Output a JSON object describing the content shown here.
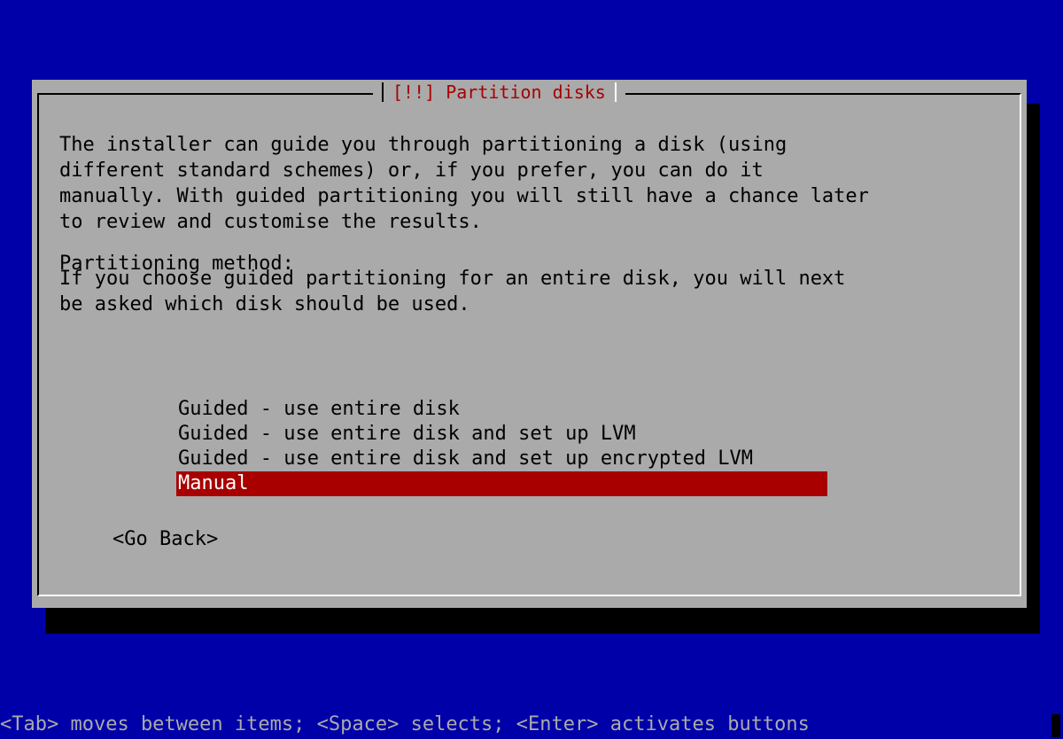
{
  "dialog": {
    "title": "[!!] Partition disks",
    "description_1": "The installer can guide you through partitioning a disk (using\ndifferent standard schemes) or, if you prefer, you can do it\nmanually. With guided partitioning you will still have a chance later\nto review and customise the results.",
    "description_2": "If you choose guided partitioning for an entire disk, you will next\nbe asked which disk should be used.",
    "prompt": "Partitioning method:",
    "options": [
      {
        "label": "Guided - use entire disk",
        "selected": false
      },
      {
        "label": "Guided - use entire disk and set up LVM",
        "selected": false
      },
      {
        "label": "Guided - use entire disk and set up encrypted LVM",
        "selected": false
      },
      {
        "label": "Manual",
        "selected": true
      }
    ],
    "go_back_label": "<Go Back>"
  },
  "footer": {
    "help_text": "<Tab> moves between items; <Space> selects; <Enter> activates buttons"
  },
  "colors": {
    "background": "#0000a8",
    "dialog": "#aaaaaa",
    "title": "#a80000",
    "selected": "#a80000",
    "shadow": "#000000"
  }
}
